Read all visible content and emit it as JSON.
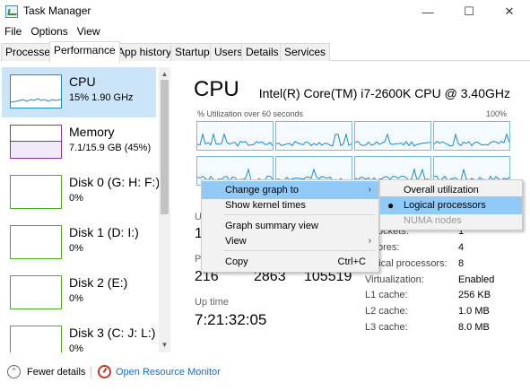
{
  "window": {
    "title": "Task Manager",
    "min": "—",
    "max": "☐",
    "close": "✕"
  },
  "menu": [
    "File",
    "Options",
    "View"
  ],
  "tabs": [
    "Processes",
    "Performance",
    "App history",
    "Startup",
    "Users",
    "Details",
    "Services"
  ],
  "active_tab": "Performance",
  "sidebar": {
    "items": [
      {
        "title": "CPU",
        "sub": "15%  1.90 GHz",
        "color": "#1a88c9"
      },
      {
        "title": "Memory",
        "sub": "7.1/15.9 GB (45%)",
        "color": "#8b2fa8"
      },
      {
        "title": "Disk 0 (G: H: F:)",
        "sub": "0%",
        "color": "#4caf1a"
      },
      {
        "title": "Disk 1 (D: I:)",
        "sub": "0%",
        "color": "#4caf1a"
      },
      {
        "title": "Disk 2 (E:)",
        "sub": "0%",
        "color": "#4caf1a"
      },
      {
        "title": "Disk 3 (C: J: L:)",
        "sub": "0%",
        "color": "#4caf1a"
      }
    ]
  },
  "main": {
    "title": "CPU",
    "cpu_name": "Intel(R) Core(TM) i7-2600K CPU @ 3.40GHz",
    "util_label": "% Utilization over 60 seconds",
    "util_max": "100%",
    "partial_u": "U",
    "partial_1": "1",
    "partial_p": "P",
    "counts": [
      "216",
      "2863",
      "105519"
    ],
    "uptime_label": "Up time",
    "uptime": "7:21:32:05",
    "info": [
      {
        "label": "ockets:",
        "value": "1"
      },
      {
        "label": "ores:",
        "value": "4"
      },
      {
        "label": "ogical processors:",
        "value": "8"
      },
      {
        "label": "Virtualization:",
        "value": "Enabled"
      },
      {
        "label": "L1 cache:",
        "value": "256 KB"
      },
      {
        "label": "L2 cache:",
        "value": "1.0 MB"
      },
      {
        "label": "L3 cache:",
        "value": "8.0 MB"
      }
    ]
  },
  "context_menu": {
    "items": [
      "Change graph to",
      "Show kernel times",
      "Graph summary view",
      "View",
      "Copy"
    ],
    "copy_shortcut": "Ctrl+C"
  },
  "submenu": {
    "items": [
      "Overall utilization",
      "Logical processors",
      "NUMA nodes"
    ],
    "selected": "Logical processors",
    "disabled": "NUMA nodes"
  },
  "footer": {
    "fewer": "Fewer details",
    "resource_monitor": "Open Resource Monitor"
  }
}
